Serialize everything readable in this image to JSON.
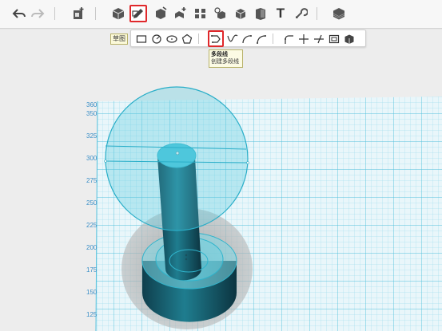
{
  "toolbar": {
    "icons": [
      "undo-icon",
      "redo-icon",
      "import-icon",
      "primitive-box-icon",
      "sketch-pencil-icon",
      "3d-edit-icon",
      "move-icon",
      "array-icon",
      "combine-icon",
      "measure-icon",
      "material-icon",
      "text-tool-icon",
      "snap-icon",
      "view-cube-icon"
    ],
    "text_tool_label": "T",
    "active_tool": "sketch-pencil-icon",
    "active_color": "#e0282b"
  },
  "sketch_bar": {
    "label": "草图",
    "tools": [
      "rectangle",
      "circle",
      "ellipse",
      "polygon",
      "polyline",
      "spline",
      "arc",
      "three-point-arc",
      "fillet",
      "trim",
      "offset",
      "frame",
      "extrude-sketch"
    ],
    "active_tool": "polyline"
  },
  "tooltip": {
    "title": "多段线",
    "description": "创建多段线"
  },
  "grid": {
    "color": "#5dc4dd",
    "labels": [
      "360",
      "350",
      "325",
      "300",
      "275",
      "250",
      "225",
      "200",
      "175",
      "150",
      "125"
    ]
  },
  "model": {
    "shape_color": "#1b6e80",
    "highlight_color": "#3ec4d8"
  }
}
